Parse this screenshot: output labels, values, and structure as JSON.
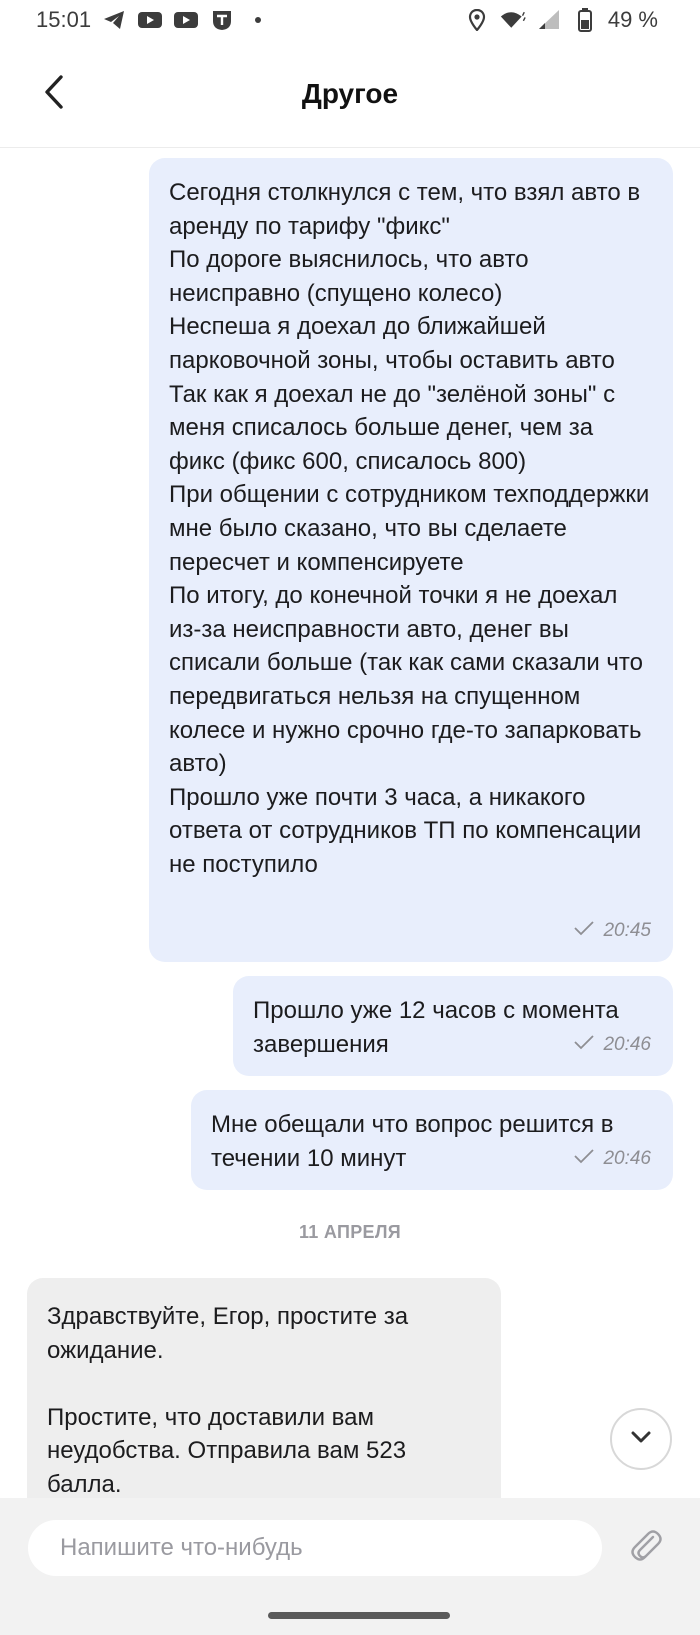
{
  "status_bar": {
    "time": "15:01",
    "battery": "49 %",
    "left_icons": [
      "telegram-icon",
      "youtube-icon",
      "youtube-icon",
      "tinkoff-icon",
      "dot-icon"
    ],
    "right_icons": [
      "location-icon",
      "wifi-icon",
      "signal-icon",
      "battery-icon"
    ]
  },
  "header": {
    "title": "Другое",
    "back_icon": "chevron-left-icon"
  },
  "messages": [
    {
      "direction": "outgoing",
      "text": "Сегодня столкнулся с тем, что взял авто в аренду по тарифу \"фикс\"\nПо дороге выяснилось, что авто неисправно (спущено колесо)\nНеспеша я доехал до ближайшей парковочной зоны, чтобы оставить авто\nТак как я доехал не до \"зелёной зоны\" с меня списалось больше денег, чем за фикс (фикс 600, списалось 800)\nПри общении с сотрудником техподдержки мне было сказано, что вы сделаете пересчет и компенсируете\nПо итогу, до конечной точки я не доехал из-за неисправности авто, денег вы списали больше (так как сами сказали что передвигаться нельзя на спущенном колесе и нужно срочно где-то запарковать авто)\nПрошло уже почти 3 часа, а никакого ответа от сотрудников ТП по компенсации не поступило",
      "time": "20:45",
      "status_icon": "check-icon"
    },
    {
      "direction": "outgoing",
      "text": "Прошло уже 12 часов с момента завершения",
      "time": "20:46",
      "status_icon": "check-icon"
    },
    {
      "direction": "outgoing",
      "text": "Мне обещали что вопрос решится в течении 10 минут",
      "time": "20:46",
      "status_icon": "check-icon"
    },
    {
      "direction": "incoming",
      "text": "Здравствуйте, Егор, простите за ожидание.\n\nПростите, что доставили вам неудобства. Отправила вам 523 балла."
    }
  ],
  "date_separator": "11 АПРЕЛЯ",
  "composer": {
    "placeholder": "Напишите что-нибудь",
    "attach_icon": "paperclip-icon"
  },
  "scroll_down_icon": "chevron-down-icon",
  "colors": {
    "outgoing_bubble": "#e8eefc",
    "incoming_bubble": "#eeeeee",
    "composer_bg": "#f2f2f2"
  }
}
